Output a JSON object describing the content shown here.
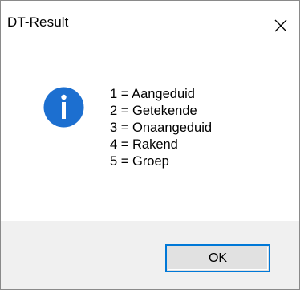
{
  "window": {
    "title": "DT-Result"
  },
  "icons": {
    "title_close": "close-icon",
    "message": "info-icon"
  },
  "colors": {
    "info_icon": "#1c6fd0",
    "button_border": "#0078d7",
    "footer_bg": "#f0f0f0"
  },
  "message": {
    "lines": [
      "1 = Aangeduid",
      "2 = Getekende",
      "3 = Onaangeduid",
      "4 = Rakend",
      "5 = Groep"
    ]
  },
  "buttons": {
    "ok_label": "OK"
  }
}
